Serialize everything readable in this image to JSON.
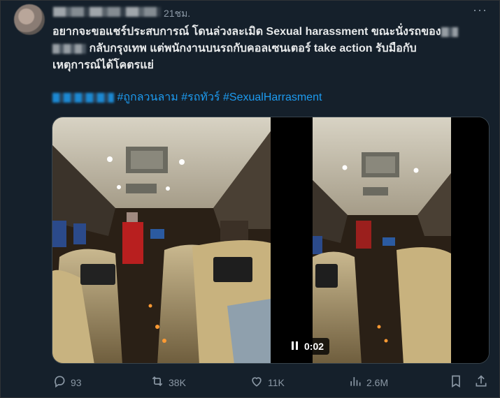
{
  "tweet": {
    "time": "21ชม.",
    "text_line1": "อยากจะขอแชร์ประสบการณ์ โดนล่วงละเมิด Sexual harassment ขณะนั่งรถของ",
    "text_line2_a": "กลับกรุงเทพ แต่พนักงานบนรถกับคอลเซนเตอร์ take action รับมือกับ",
    "text_line3": "เหตุการณ์ได้โคตรแย่",
    "hashtags": [
      "#ถูกลวนลาม",
      "#รถทัวร์",
      "#SexualHarrasment"
    ]
  },
  "media": {
    "video_time": "0:02"
  },
  "actions": {
    "replies": "93",
    "retweets": "38K",
    "likes": "11K",
    "views": "2.6M"
  },
  "icons": [
    "more-icon",
    "reply-icon",
    "retweet-icon",
    "like-icon",
    "views-icon",
    "bookmark-icon",
    "share-icon",
    "pause-icon"
  ],
  "colors": {
    "background": "#15202b",
    "link": "#1d9bf0",
    "muted": "#8b98a5",
    "text": "#e7e9ea"
  }
}
